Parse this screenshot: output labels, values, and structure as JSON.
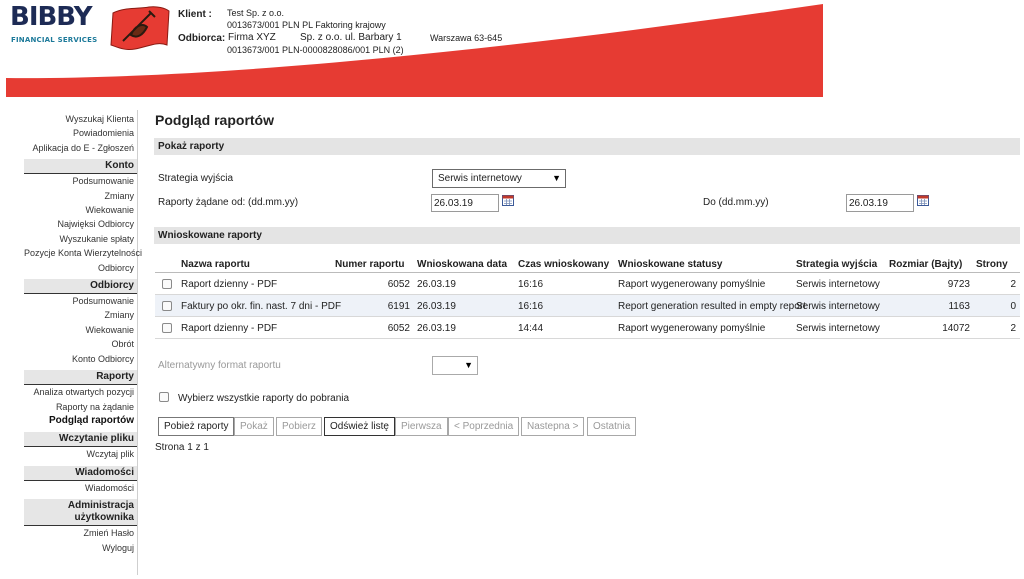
{
  "brand": {
    "logo_text": "BIBBY",
    "logo_subtitle": "FINANCIAL SERVICES",
    "accent_red": "#e63b33",
    "navy": "#1d2b55"
  },
  "header": {
    "client_label": "Klient :",
    "client_name": "Test Sp. z o.o.",
    "client_account": "0013673/001 PLN PL Faktoring krajowy",
    "debtor_label": "Odbiorca:",
    "debtor_name": "Firma XYZ",
    "debtor_address": "Sp. z o.o. ul. Barbary 1",
    "debtor_city": "Warszawa 63-645",
    "debtor_account": "0013673/001 PLN-0000828086/001 PLN (2)"
  },
  "sidebar": {
    "top_links": [
      "Wyszukaj Klienta",
      "Powiadomienia",
      "Aplikacja do E - Zgłoszeń"
    ],
    "sections": [
      {
        "title": "Konto",
        "items": [
          "Podsumowanie",
          "Zmiany",
          "Wiekowanie",
          "Najwięksi Odbiorcy",
          "Wyszukanie spłaty",
          "Pozycje Konta Wierzytelności",
          "Odbiorcy"
        ]
      },
      {
        "title": "Odbiorcy",
        "items": [
          "Podsumowanie",
          "Zmiany",
          "Wiekowanie",
          "Obrót",
          "Konto Odbiorcy"
        ]
      },
      {
        "title": "Raporty",
        "items": [
          "Analiza otwartych pozycji",
          "Raporty na żądanie",
          "Podgląd raportów"
        ]
      },
      {
        "title": "Wczytanie pliku",
        "items": [
          "Wczytaj plik"
        ]
      },
      {
        "title": "Wiadomości",
        "items": [
          "Wiadomości"
        ]
      },
      {
        "title": "Administracja użytkownika",
        "items": [
          "Zmień Hasło",
          "Wyloguj"
        ]
      }
    ],
    "active_item": "Podgląd raportów"
  },
  "main": {
    "page_title": "Podgląd raportów",
    "show_reports_bar": "Pokaż raporty",
    "output_strategy_label": "Strategia wyjścia",
    "output_strategy_value": "Serwis internetowy",
    "date_from_label": "Raporty żądane od: (dd.mm.yy)",
    "date_from_value": "26.03.19",
    "date_to_label": "Do (dd.mm.yy)",
    "date_to_value": "26.03.19",
    "requested_reports_bar": "Wnioskowane raporty",
    "table": {
      "columns": [
        "Nazwa raportu",
        "Numer raportu",
        "Wnioskowana data",
        "Czas wnioskowany",
        "Wnioskowane statusy",
        "Strategia wyjścia",
        "Rozmiar (Bajty)",
        "Strony"
      ],
      "rows": [
        {
          "name": "Raport dzienny - PDF",
          "number": "6052",
          "date": "26.03.19",
          "time": "16:16",
          "status": "Raport wygenerowany pomyślnie",
          "strategy": "Serwis internetowy",
          "size": "9723",
          "pages": "2"
        },
        {
          "name": "Faktury po okr. fin. nast. 7 dni - PDF",
          "number": "6191",
          "date": "26.03.19",
          "time": "16:16",
          "status": "Report generation resulted in empty report",
          "strategy": "Serwis internetowy",
          "size": "1163",
          "pages": "0"
        },
        {
          "name": "Raport dzienny - PDF",
          "number": "6052",
          "date": "26.03.19",
          "time": "14:44",
          "status": "Raport wygenerowany pomyślnie",
          "strategy": "Serwis internetowy",
          "size": "14072",
          "pages": "2"
        }
      ]
    },
    "alt_format_label": "Alternatywny format raportu",
    "alt_format_value": "",
    "select_all_label": "Wybierz wszystkie raporty do pobrania",
    "buttons": {
      "download": "Pobież raporty",
      "show": "Pokaż",
      "fetch": "Pobierz",
      "refresh": "Odśwież listę",
      "first": "Pierwsza",
      "prev": "< Poprzednia",
      "next": "Nastepna >",
      "last": "Ostatnia"
    },
    "pagination_text": "Strona 1 z 1"
  }
}
